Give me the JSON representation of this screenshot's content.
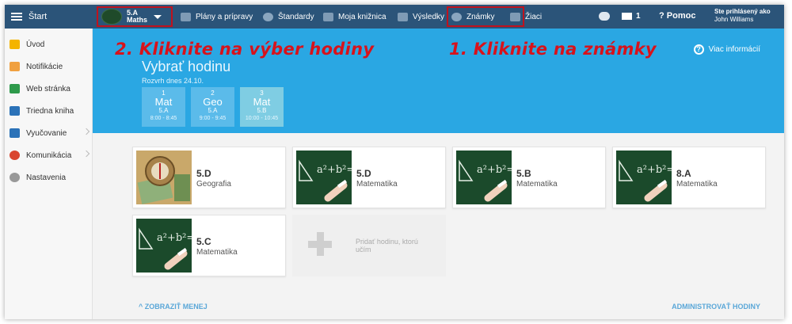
{
  "topbar": {
    "start_label": "Štart",
    "class_label": "5.A",
    "subject_label": "Maths",
    "nav": [
      {
        "label": "Plány a prípravy",
        "icon": "plans-icon"
      },
      {
        "label": "Štandardy",
        "icon": "shield-icon"
      },
      {
        "label": "Moja knižnica",
        "icon": "library-icon"
      },
      {
        "label": "Výsledky",
        "icon": "chart-icon"
      },
      {
        "label": "Známky",
        "icon": "grades-icon"
      },
      {
        "label": "Žiaci",
        "icon": "students-icon"
      }
    ],
    "mail_count": "1",
    "help_label": "Pomoc",
    "logged_in_label": "Ste prihlásený ako",
    "user_name": "John Williams"
  },
  "sidebar": {
    "items": [
      {
        "label": "Úvod",
        "icon": "star-icon",
        "color": "#f4b400"
      },
      {
        "label": "Notifikácie",
        "icon": "envelope-icon",
        "color": "#f0a040"
      },
      {
        "label": "Web stránka",
        "icon": "home-icon",
        "color": "#2e9a4b"
      },
      {
        "label": "Triedna kniha",
        "icon": "book-icon",
        "color": "#2b72b8"
      },
      {
        "label": "Vyučovanie",
        "icon": "teaching-icon",
        "color": "#2b72b8"
      },
      {
        "label": "Komunikácia",
        "icon": "chat-icon",
        "color": "#d9452f"
      },
      {
        "label": "Nastavenia",
        "icon": "gear-icon",
        "color": "#999999"
      }
    ]
  },
  "annotations": {
    "step2": "2. Kliknite na výber hodiny",
    "step1": "1. Kliknite na známky"
  },
  "hero": {
    "title": "Vybrať hodinu",
    "date_label": "Rozvrh dnes 24.10.",
    "more_info": "Viac informácií",
    "periods": [
      {
        "num": "1",
        "subject": "Mat",
        "class": "5.A",
        "time": "8:00 - 8:45"
      },
      {
        "num": "2",
        "subject": "Geo",
        "class": "5.A",
        "time": "9:00 - 9:45"
      },
      {
        "num": "3",
        "subject": "Mat",
        "class": "5.B",
        "time": "10:00 - 10:45"
      }
    ]
  },
  "cards": [
    {
      "class": "5.D",
      "subject": "Geografia",
      "image": "compass-map-image"
    },
    {
      "class": "5.D",
      "subject": "Matematika",
      "image": "chalkboard-image"
    },
    {
      "class": "5.B",
      "subject": "Matematika",
      "image": "chalkboard-image"
    },
    {
      "class": "8.A",
      "subject": "Matematika",
      "image": "chalkboard-image"
    },
    {
      "class": "5.C",
      "subject": "Matematika",
      "image": "chalkboard-image"
    }
  ],
  "add_card": {
    "label": "Pridať hodinu, ktorú učím"
  },
  "footer": {
    "show_less": "ZOBRAZIŤ MENEJ",
    "manage": "ADMINISTROVAŤ HODINY"
  },
  "colors": {
    "topbar": "#2b5479",
    "hero": "#2aa7e3",
    "annotation": "#d8121b",
    "link": "#5aa7d8"
  }
}
